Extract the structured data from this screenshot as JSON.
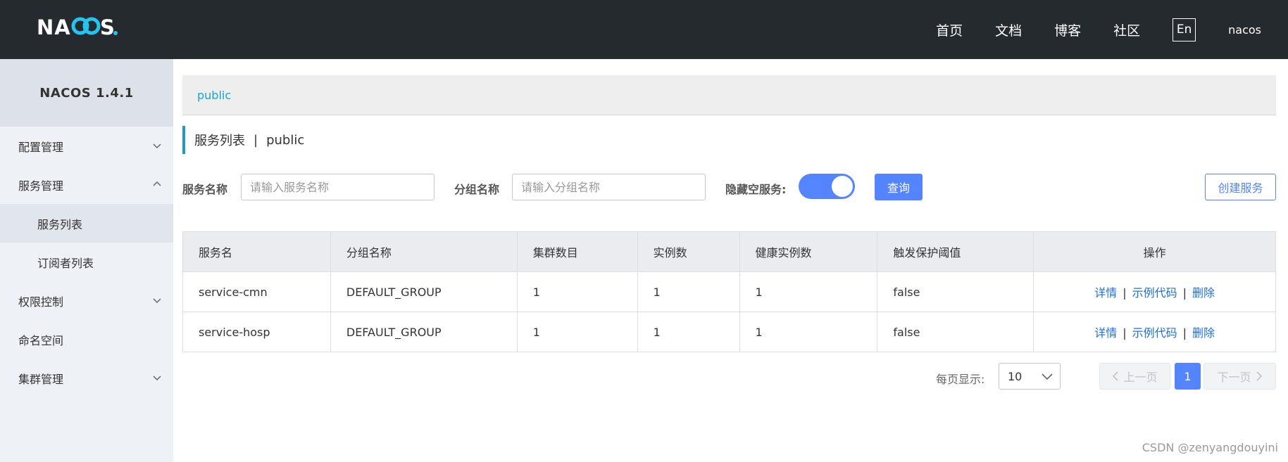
{
  "header": {
    "logo_text": "NACOS.",
    "nav": [
      "首页",
      "文档",
      "博客",
      "社区"
    ],
    "lang_button": "En",
    "user": "nacos"
  },
  "sidebar": {
    "title": "NACOS 1.4.1",
    "items": [
      {
        "label": "配置管理",
        "icon": "chevron-down-icon"
      },
      {
        "label": "服务管理",
        "icon": "chevron-up-icon"
      },
      {
        "label": "服务列表"
      },
      {
        "label": "订阅者列表"
      },
      {
        "label": "权限控制",
        "icon": "chevron-down-icon"
      },
      {
        "label": "命名空间"
      },
      {
        "label": "集群管理",
        "icon": "chevron-down-icon"
      }
    ]
  },
  "namespace": "public",
  "page_title": {
    "main": "服务列表",
    "separator": "|",
    "namespace": "public"
  },
  "filters": {
    "service_label": "服务名称",
    "service_placeholder": "请输入服务名称",
    "group_label": "分组名称",
    "group_placeholder": "请输入分组名称",
    "hide_empty_label": "隐藏空服务:",
    "hide_empty_on": true,
    "query_button": "查询",
    "create_button": "创建服务"
  },
  "table": {
    "columns": [
      "服务名",
      "分组名称",
      "集群数目",
      "实例数",
      "健康实例数",
      "触发保护阈值",
      "操作"
    ],
    "rows": [
      {
        "name": "service-cmn",
        "group": "DEFAULT_GROUP",
        "clusters": "1",
        "instances": "1",
        "healthy": "1",
        "threshold": "false"
      },
      {
        "name": "service-hosp",
        "group": "DEFAULT_GROUP",
        "clusters": "1",
        "instances": "1",
        "healthy": "1",
        "threshold": "false"
      }
    ],
    "ops": {
      "detail": "详情",
      "sample": "示例代码",
      "delete": "删除",
      "sep": "|"
    }
  },
  "pagination": {
    "page_size_label": "每页显示:",
    "page_size": "10",
    "prev": "上一页",
    "next": "下一页",
    "current_page": "1"
  },
  "watermark": "CSDN @zenyangdouyini",
  "colors": {
    "header_bg": "#252a2f",
    "primary": "#5584ff",
    "link": "#1f6fd6",
    "accent": "#18a6cc"
  }
}
